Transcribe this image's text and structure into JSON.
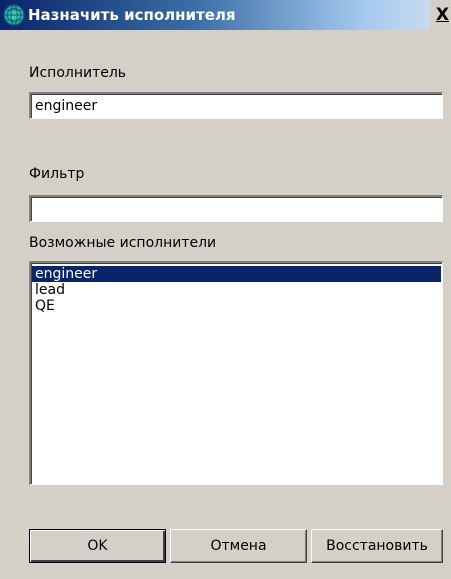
{
  "window": {
    "title": "Назначить исполнителя",
    "icon": "globe-icon",
    "close_label": "X"
  },
  "assignee": {
    "label": "Исполнитель",
    "value": "engineer"
  },
  "filter": {
    "label": "Фильтр",
    "value": ""
  },
  "candidates": {
    "label": "Возможные исполнители",
    "items": [
      {
        "label": "engineer",
        "selected": true
      },
      {
        "label": "lead",
        "selected": false
      },
      {
        "label": "QE",
        "selected": false
      }
    ]
  },
  "buttons": {
    "ok": "OK",
    "cancel": "Отмена",
    "restore": "Восстановить"
  },
  "colors": {
    "selection": "#0a246a",
    "dialog_face": "#d4d0c8",
    "title_start": "#0a246a"
  }
}
